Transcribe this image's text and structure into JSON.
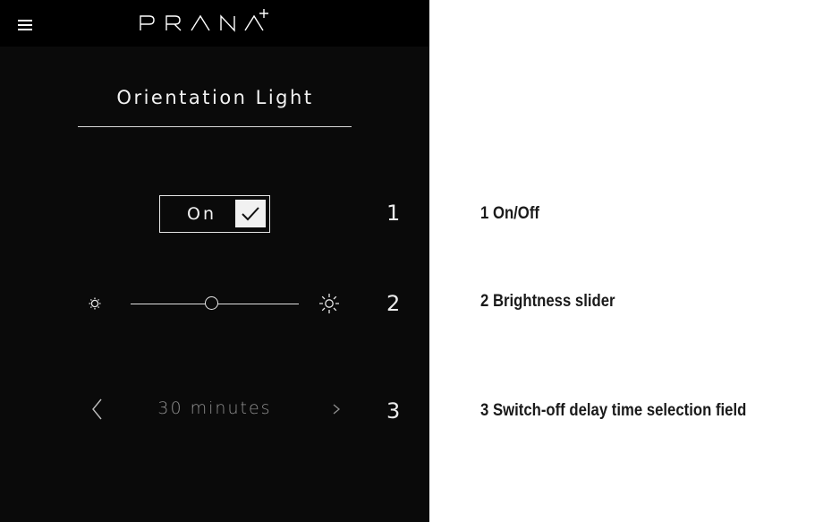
{
  "app": {
    "brand": "PRANA+",
    "menu_icon": "hamburger-menu-icon"
  },
  "page": {
    "title": "Orientation Light"
  },
  "toggle": {
    "label": "On",
    "checked": true,
    "icon": "checkmark-icon"
  },
  "brightness": {
    "level": 0.48,
    "min_icon": "sun-dim-icon",
    "max_icon": "sun-bright-icon"
  },
  "delay": {
    "value": "30 minutes",
    "prev_icon": "chevron-left-icon",
    "next_icon": "chevron-right-icon"
  },
  "markers": [
    "1",
    "2",
    "3"
  ],
  "legend": [
    {
      "text": "1 On/Off"
    },
    {
      "text": "2 Brightness slider"
    },
    {
      "text": "3 Switch-off delay time selection field"
    }
  ],
  "colors": {
    "background": "#0a0a0a",
    "topbar": "#000000",
    "foreground": "#f2f2f2",
    "muted": "#8f8f8f"
  }
}
